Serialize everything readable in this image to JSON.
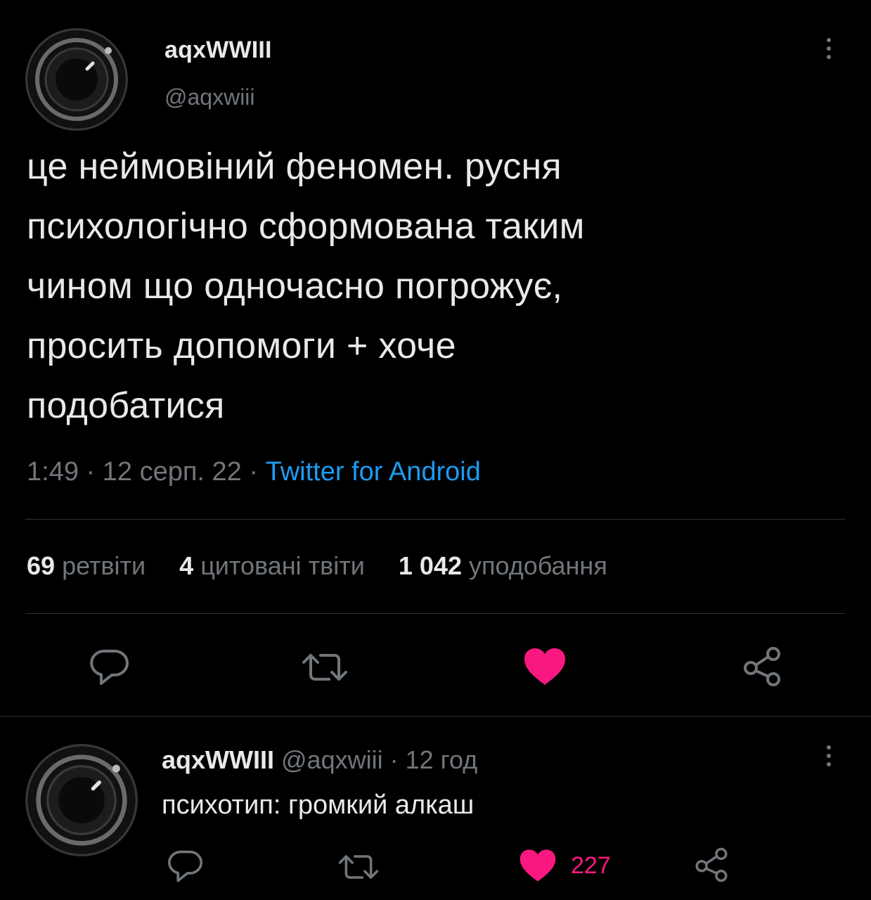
{
  "tweet": {
    "display_name": "aqxWWIII",
    "handle": "@aqxwiii",
    "text": "це неймовіний феномен. русня\nпсихологічно сформована таким\nчином що одночасно погрожує,\nпросить допомоги + хоче\nподобатися",
    "time": "1:49",
    "date": "12 серп. 22",
    "separator": "·",
    "source": "Twitter for Android",
    "stats": {
      "retweets_count": "69",
      "retweets_label": "ретвіти",
      "quotes_count": "4",
      "quotes_label": "цитовані твіти",
      "likes_count": "1 042",
      "likes_label": "уподобання"
    },
    "actions": [
      {
        "icon": "reply-icon"
      },
      {
        "icon": "retweet-icon"
      },
      {
        "icon": "heart-filled-icon"
      },
      {
        "icon": "share-icon"
      }
    ]
  },
  "reply": {
    "display_name": "aqxWWIII",
    "handle": "@aqxwiii",
    "separator": "·",
    "time_ago": "12 год",
    "text": "психотип: громкий алкаш",
    "like_count": "227",
    "actions": [
      {
        "icon": "reply-icon"
      },
      {
        "icon": "retweet-icon"
      },
      {
        "icon": "heart-filled-icon"
      },
      {
        "icon": "share-icon"
      }
    ]
  },
  "colors": {
    "background": "#000000",
    "text": "#e7e9ea",
    "secondary": "#71767b",
    "link": "#1d9bf0",
    "like": "#f91880",
    "divider": "#2f3336"
  }
}
